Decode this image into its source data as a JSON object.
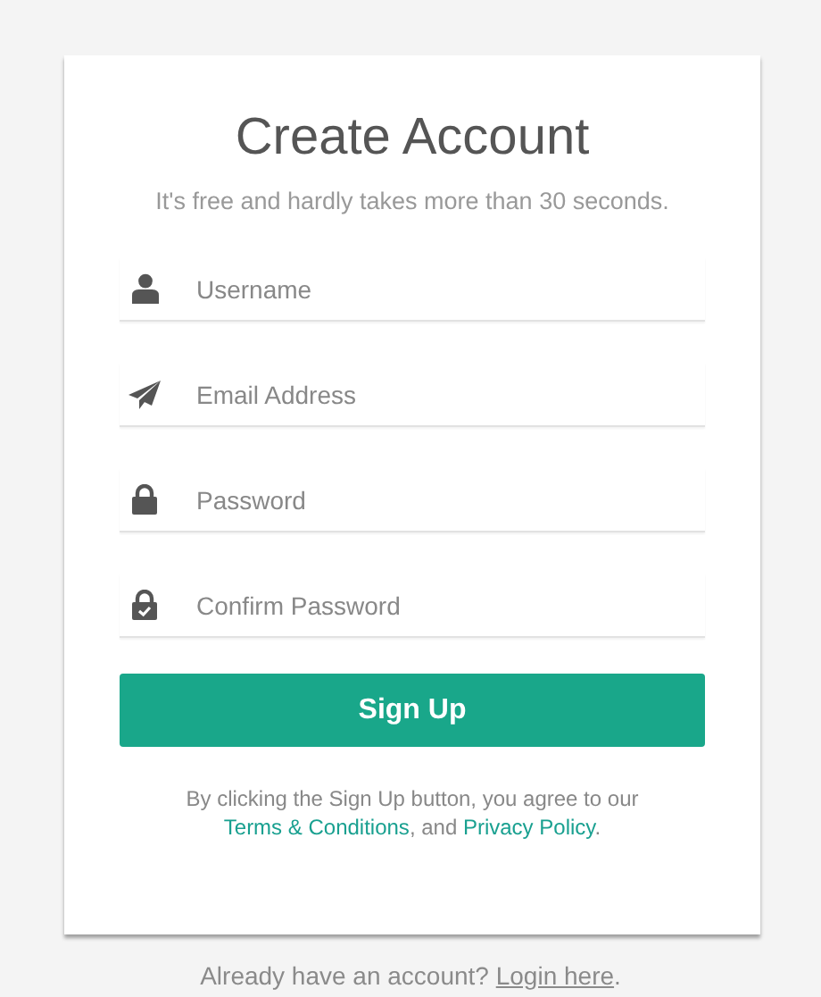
{
  "title": "Create Account",
  "subtitle": "It's free and hardly takes more than 30 seconds.",
  "fields": [
    {
      "kind": "user",
      "placeholder": "Username"
    },
    {
      "kind": "plane",
      "placeholder": "Email Address"
    },
    {
      "kind": "lock",
      "placeholder": "Password"
    },
    {
      "kind": "lock-check",
      "placeholder": "Confirm Password"
    }
  ],
  "button": "Sign Up",
  "agreement": {
    "before": "By clicking the Sign Up button, you agree to our",
    "terms_link": "Terms & Conditions",
    "middle": ", and",
    "privacy_link": "Privacy Policy",
    "after": "."
  },
  "footer": {
    "text": "Already have an account?",
    "link": "Login here",
    "after": "."
  }
}
